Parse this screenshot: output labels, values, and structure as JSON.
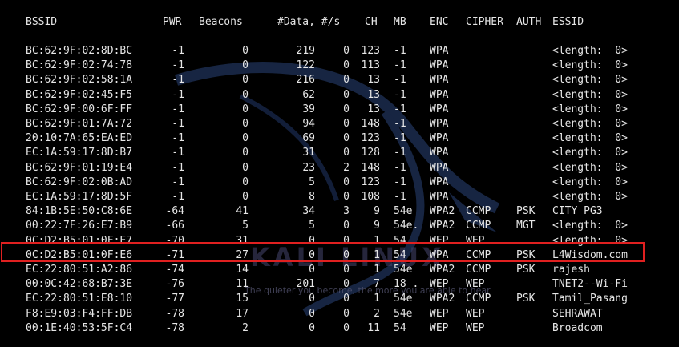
{
  "header": {
    "bssid": "BSSID",
    "pwr": "PWR",
    "beacons": "Beacons",
    "data": "#Data, #/s",
    "ch": "CH",
    "mb": "MB",
    "enc": "ENC",
    "cipher": "CIPHER",
    "auth": "AUTH",
    "essid": "ESSID"
  },
  "rows": [
    {
      "bssid": "BC:62:9F:02:8D:BC",
      "pwr": "-1",
      "beacons": "0",
      "data": "219",
      "rate": "0",
      "ch": "123",
      "mb": "-1",
      "enc": "WPA",
      "cipher": "",
      "auth": "",
      "essid": "<length:  0>"
    },
    {
      "bssid": "BC:62:9F:02:74:78",
      "pwr": "-1",
      "beacons": "0",
      "data": "122",
      "rate": "0",
      "ch": "113",
      "mb": "-1",
      "enc": "WPA",
      "cipher": "",
      "auth": "",
      "essid": "<length:  0>"
    },
    {
      "bssid": "BC:62:9F:02:58:1A",
      "pwr": "-1",
      "beacons": "0",
      "data": "216",
      "rate": "0",
      "ch": "13",
      "mb": "-1",
      "enc": "WPA",
      "cipher": "",
      "auth": "",
      "essid": "<length:  0>"
    },
    {
      "bssid": "BC:62:9F:02:45:F5",
      "pwr": "-1",
      "beacons": "0",
      "data": "62",
      "rate": "0",
      "ch": "13",
      "mb": "-1",
      "enc": "WPA",
      "cipher": "",
      "auth": "",
      "essid": "<length:  0>"
    },
    {
      "bssid": "BC:62:9F:00:6F:FF",
      "pwr": "-1",
      "beacons": "0",
      "data": "39",
      "rate": "0",
      "ch": "13",
      "mb": "-1",
      "enc": "WPA",
      "cipher": "",
      "auth": "",
      "essid": "<length:  0>"
    },
    {
      "bssid": "BC:62:9F:01:7A:72",
      "pwr": "-1",
      "beacons": "0",
      "data": "94",
      "rate": "0",
      "ch": "148",
      "mb": "-1",
      "enc": "WPA",
      "cipher": "",
      "auth": "",
      "essid": "<length:  0>"
    },
    {
      "bssid": "20:10:7A:65:EA:ED",
      "pwr": "-1",
      "beacons": "0",
      "data": "69",
      "rate": "0",
      "ch": "123",
      "mb": "-1",
      "enc": "WPA",
      "cipher": "",
      "auth": "",
      "essid": "<length:  0>"
    },
    {
      "bssid": "EC:1A:59:17:8D:B7",
      "pwr": "-1",
      "beacons": "0",
      "data": "31",
      "rate": "0",
      "ch": "128",
      "mb": "-1",
      "enc": "WPA",
      "cipher": "",
      "auth": "",
      "essid": "<length:  0>"
    },
    {
      "bssid": "BC:62:9F:01:19:E4",
      "pwr": "-1",
      "beacons": "0",
      "data": "23",
      "rate": "2",
      "ch": "148",
      "mb": "-1",
      "enc": "WPA",
      "cipher": "",
      "auth": "",
      "essid": "<length:  0>"
    },
    {
      "bssid": "BC:62:9F:02:0B:AD",
      "pwr": "-1",
      "beacons": "0",
      "data": "5",
      "rate": "0",
      "ch": "123",
      "mb": "-1",
      "enc": "WPA",
      "cipher": "",
      "auth": "",
      "essid": "<length:  0>"
    },
    {
      "bssid": "EC:1A:59:17:8D:5F",
      "pwr": "-1",
      "beacons": "0",
      "data": "8",
      "rate": "0",
      "ch": "108",
      "mb": "-1",
      "enc": "WPA",
      "cipher": "",
      "auth": "",
      "essid": "<length:  0>"
    },
    {
      "bssid": "84:1B:5E:50:C8:6E",
      "pwr": "-64",
      "beacons": "41",
      "data": "34",
      "rate": "3",
      "ch": "9",
      "mb": "54e",
      "enc": "WPA2",
      "cipher": "CCMP",
      "auth": "PSK",
      "essid": "CITY PG3"
    },
    {
      "bssid": "00:22:7F:26:E7:B9",
      "pwr": "-66",
      "beacons": "5",
      "data": "5",
      "rate": "0",
      "ch": "9",
      "mb": "54e.",
      "enc": "WPA2",
      "cipher": "CCMP",
      "auth": "MGT",
      "essid": "<length:  0>"
    },
    {
      "bssid": "0C:D2:B5:01:0F:E7",
      "pwr": "-70",
      "beacons": "31",
      "data": "0",
      "rate": "0",
      "ch": "1",
      "mb": "54",
      "enc": "WEP",
      "cipher": "WEP",
      "auth": "",
      "essid": "<length:  0>"
    },
    {
      "bssid": "0C:D2:B5:01:0F:E6",
      "pwr": "-71",
      "beacons": "27",
      "data": "0",
      "rate": "0",
      "ch": "1",
      "mb": "54",
      "enc": "WPA",
      "cipher": "CCMP",
      "auth": "PSK",
      "essid": "L4Wisdom.com"
    },
    {
      "bssid": "EC:22:80:51:A2:86",
      "pwr": "-74",
      "beacons": "14",
      "data": "0",
      "rate": "0",
      "ch": "1",
      "mb": "54e",
      "enc": "WPA2",
      "cipher": "CCMP",
      "auth": "PSK",
      "essid": "rajesh"
    },
    {
      "bssid": "00:0C:42:68:B7:3E",
      "pwr": "-76",
      "beacons": "11",
      "data": "201",
      "rate": "0",
      "ch": "7",
      "mb": "18 .",
      "enc": "WEP",
      "cipher": "WEP",
      "auth": "",
      "essid": "TNET2--Wi-Fi"
    },
    {
      "bssid": "EC:22:80:51:E8:10",
      "pwr": "-77",
      "beacons": "15",
      "data": "0",
      "rate": "0",
      "ch": "1",
      "mb": "54e",
      "enc": "WPA2",
      "cipher": "CCMP",
      "auth": "PSK",
      "essid": "Tamil_Pasang"
    },
    {
      "bssid": "F8:E9:03:F4:FF:DB",
      "pwr": "-78",
      "beacons": "17",
      "data": "0",
      "rate": "0",
      "ch": "2",
      "mb": "54e",
      "enc": "WEP",
      "cipher": "WEP",
      "auth": "",
      "essid": "SEHRAWAT"
    },
    {
      "bssid": "00:1E:40:53:5F:C4",
      "pwr": "-78",
      "beacons": "2",
      "data": "0",
      "rate": "0",
      "ch": "11",
      "mb": "54",
      "enc": "WEP",
      "cipher": "WEP",
      "auth": "",
      "essid": "Broadcom"
    }
  ],
  "highlighted_row_index": 14,
  "watermark": "KALI LINUX",
  "tagline": "The quieter you become, the more you are able to hear",
  "highlight_color": "#e02020"
}
